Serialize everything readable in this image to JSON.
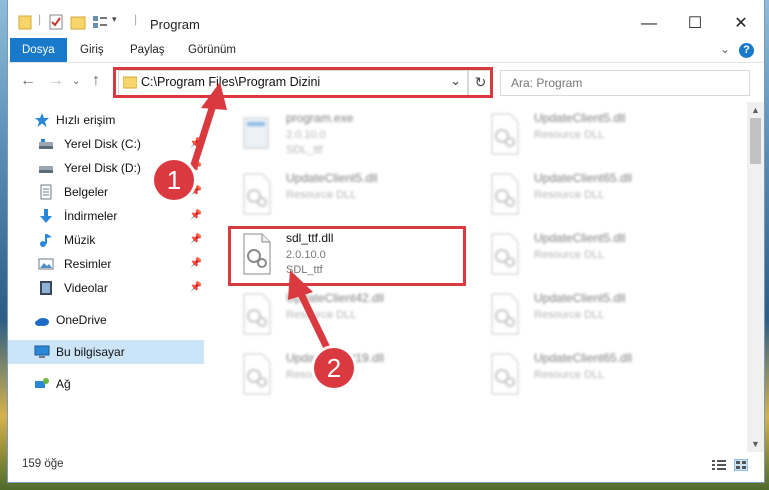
{
  "window": {
    "title": "Program",
    "minimize_glyph": "—",
    "maximize_glyph": "☐",
    "close_glyph": "✕"
  },
  "ribbon": {
    "tabs": [
      "Dosya",
      "Giriş",
      "Paylaş",
      "Görünüm"
    ],
    "help_label": "?"
  },
  "address": {
    "path": "C:\\Program Files\\Program Dizini",
    "search_placeholder": "Ara: Program"
  },
  "sidebar": {
    "items": [
      {
        "label": "Hızlı erişim",
        "icon": "star-icon"
      },
      {
        "label": "Yerel Disk (C:)",
        "icon": "drive-icon",
        "pinned": true
      },
      {
        "label": "Yerel Disk (D:)",
        "icon": "drive-icon",
        "pinned": true
      },
      {
        "label": "Belgeler",
        "icon": "documents-icon",
        "pinned": true
      },
      {
        "label": "İndirmeler",
        "icon": "download-icon",
        "pinned": true
      },
      {
        "label": "Müzik",
        "icon": "music-icon",
        "pinned": true
      },
      {
        "label": "Resimler",
        "icon": "pictures-icon",
        "pinned": true
      },
      {
        "label": "Videolar",
        "icon": "videos-icon",
        "pinned": true
      },
      {
        "label": "OneDrive",
        "icon": "cloud-icon"
      },
      {
        "label": "Bu bilgisayar",
        "icon": "computer-icon",
        "selected": true
      },
      {
        "label": "Ağ",
        "icon": "network-icon"
      }
    ]
  },
  "files": [
    {
      "name": "program.exe",
      "line1": "2.0.10.0",
      "line2": "SDL_ttf",
      "blurred": true,
      "type": "exe"
    },
    {
      "name": "UpdateClient5.dll",
      "line1": "Resource DLL",
      "line2": "",
      "blurred": true,
      "type": "dll"
    },
    {
      "name": "UpdateClient5.dll",
      "line1": "Resource DLL",
      "line2": "",
      "blurred": true,
      "type": "dll"
    },
    {
      "name": "UpdateClient65.dll",
      "line1": "Resource DLL",
      "line2": "",
      "blurred": true,
      "type": "dll"
    },
    {
      "name": "sdl_ttf.dll",
      "line1": "2.0.10.0",
      "line2": "SDL_ttf",
      "blurred": false,
      "type": "dll"
    },
    {
      "name": "UpdateClient5.dll",
      "line1": "Resource DLL",
      "line2": "",
      "blurred": true,
      "type": "dll"
    },
    {
      "name": "UpdateClient42.dll",
      "line1": "Resource DLL",
      "line2": "",
      "blurred": true,
      "type": "dll"
    },
    {
      "name": "UpdateClient5.dll",
      "line1": "Resource DLL",
      "line2": "",
      "blurred": true,
      "type": "dll"
    },
    {
      "name": "UpdateClient19.dll",
      "line1": "Resource DLL",
      "line2": "",
      "blurred": true,
      "type": "dll"
    },
    {
      "name": "UpdateClient65.dll",
      "line1": "Resource DLL",
      "line2": "",
      "blurred": true,
      "type": "dll"
    }
  ],
  "status": {
    "item_count": "159 öğe"
  },
  "callouts": {
    "step1": "1",
    "step2": "2",
    "color": "#d9393f"
  }
}
